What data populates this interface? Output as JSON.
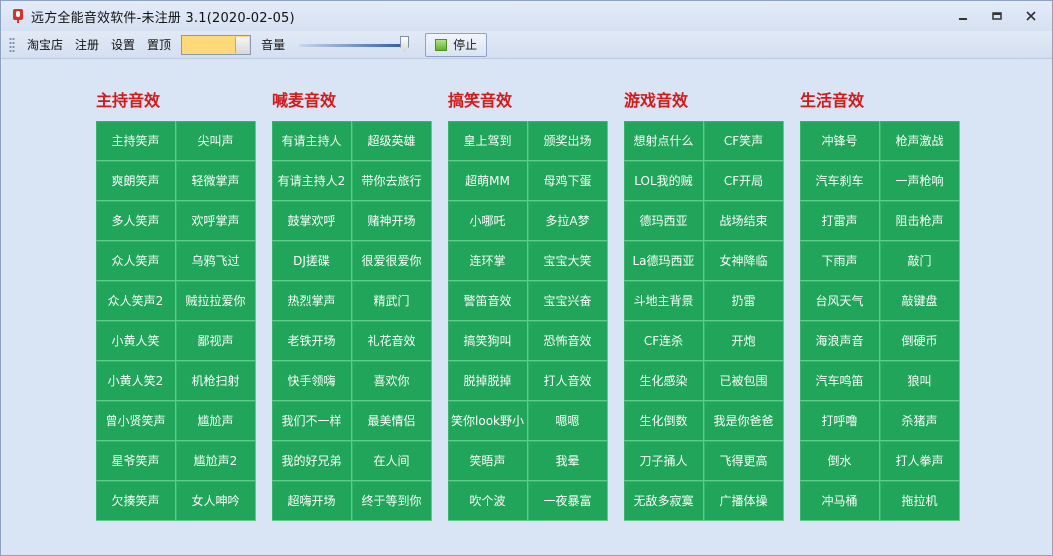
{
  "window": {
    "title": "远方全能音效软件-未注册 3.1(2020-02-05)",
    "controls": [
      {
        "name": "minimize-button",
        "icon": "minimize-icon"
      },
      {
        "name": "restore-button",
        "icon": "restore-icon"
      },
      {
        "name": "close-button",
        "icon": "close-icon"
      }
    ]
  },
  "toolbar": {
    "menu": [
      "淘宝店",
      "注册",
      "设置",
      "置顶"
    ],
    "color_box_color": "#fdd97a",
    "volume_label": "音量",
    "volume_level": 1.0,
    "stop_label": "停止"
  },
  "categories": [
    {
      "title": "主持音效",
      "buttons": [
        "主持笑声",
        "尖叫声",
        "爽朗笑声",
        "轻微掌声",
        "多人笑声",
        "欢呼掌声",
        "众人笑声",
        "乌鸦飞过",
        "众人笑声2",
        "贼拉拉爱你",
        "小黄人笑",
        "鄙视声",
        "小黄人笑2",
        "机枪扫射",
        "曾小贤笑声",
        "尴尬声",
        "星爷笑声",
        "尴尬声2",
        "欠揍笑声",
        "女人呻吟"
      ]
    },
    {
      "title": "喊麦音效",
      "buttons": [
        "有请主持人",
        "超级英雄",
        "有请主持人2",
        "带你去旅行",
        "鼓掌欢呼",
        "赌神开场",
        "DJ搓碟",
        "很爱很爱你",
        "热烈掌声",
        "精武门",
        "老铁开场",
        "礼花音效",
        "快手领嗨",
        "喜欢你",
        "我们不一样",
        "最美情侣",
        "我的好兄弟",
        "在人间",
        "超嗨开场",
        "终于等到你"
      ]
    },
    {
      "title": "搞笑音效",
      "buttons": [
        "皇上驾到",
        "颁奖出场",
        "超萌MM",
        "母鸡下蛋",
        "小哪吒",
        "多拉A梦",
        "连环掌",
        "宝宝大笑",
        "警笛音效",
        "宝宝兴奋",
        "搞笑狗叫",
        "恐怖音效",
        "脱掉脱掉",
        "打人音效",
        "笑你look野小",
        "嗯嗯",
        "笑晤声",
        "我晕",
        "吹个波",
        "一夜暴富"
      ]
    },
    {
      "title": "游戏音效",
      "buttons": [
        "想射点什么",
        "CF笑声",
        "LOL我的贼",
        "CF开局",
        "德玛西亚",
        "战场结束",
        "La德玛西亚",
        "女神降临",
        "斗地主背景",
        "扔雷",
        "CF连杀",
        "开炮",
        "生化感染",
        "已被包围",
        "生化倒数",
        "我是你爸爸",
        "刀子捅人",
        "飞得更高",
        "无敌多寂寞",
        "广播体操"
      ]
    },
    {
      "title": "生活音效",
      "buttons": [
        "冲锋号",
        "枪声激战",
        "汽车刹车",
        "一声枪响",
        "打雷声",
        "阻击枪声",
        "下雨声",
        "敲门",
        "台风天气",
        "敲键盘",
        "海浪声音",
        "倒硬币",
        "汽车鸣笛",
        "狼叫",
        "打呼噜",
        "杀猪声",
        "倒水",
        "打人拳声",
        "冲马桶",
        "拖拉机"
      ]
    }
  ]
}
